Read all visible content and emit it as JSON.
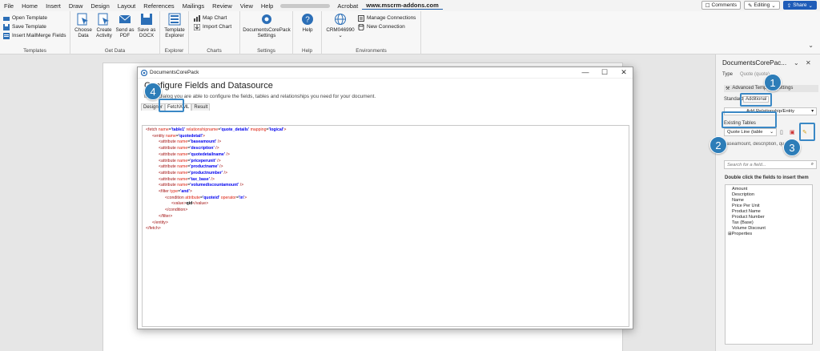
{
  "menubar": {
    "items": [
      "File",
      "Home",
      "Insert",
      "Draw",
      "Design",
      "Layout",
      "References",
      "Mailings",
      "Review",
      "View",
      "Help"
    ],
    "acrobat": "Acrobat",
    "active_tab": "www.mscrm-addons.com",
    "comments": "Comments",
    "editing": "Editing",
    "share": "Share"
  },
  "ribbon": {
    "templates": {
      "open": "Open Template",
      "save": "Save Template",
      "insert": "Insert MailMerge Fields",
      "label": "Templates"
    },
    "getdata": {
      "choose": "Choose Data",
      "create": "Create Activity",
      "sendpdf": "Send as PDF",
      "savedocx": "Save as DOCX",
      "label": "Get Data"
    },
    "explorer": {
      "btn": "Template Explorer",
      "label": "Explorer"
    },
    "charts": {
      "map": "Map Chart",
      "import": "Import Chart",
      "label": "Charts"
    },
    "settings": {
      "btn": "DocumentsCorePack Settings",
      "label": "Settings"
    },
    "help": {
      "btn": "Help",
      "label": "Help"
    },
    "env": {
      "crm": "CRM046990",
      "manage": "Manage Connections",
      "new": "New Connection",
      "label": "Environments"
    }
  },
  "dialog": {
    "title": "DocumentsCorePack",
    "heading": "Configure Fields and Datasource",
    "subtitle": "In this dialog you are able to configure the fields, tables and relationships you need for your document.",
    "tabs": [
      "Designer",
      "FetchXML",
      "Result"
    ]
  },
  "xml": {
    "l1": {
      "fetch": "fetch",
      "n1": "name",
      "v1": "'table1'",
      "n2": "relationshipname",
      "v2": "'quote_details'",
      "n3": "mapping",
      "v3": "'logical'"
    },
    "l2": {
      "entity": "entity",
      "n": "name",
      "v": "'quotedetail'"
    },
    "attributes": [
      "'baseamount'",
      "'description'",
      "'quotedetailname'",
      "'priceperunit'",
      "'productname'",
      "'productnumber'",
      "'tax_base'",
      "'volumediscountamount'"
    ],
    "attr_tag": "attribute",
    "name_attr": "name",
    "filter": {
      "tag": "filter",
      "n": "type",
      "v": "'and'"
    },
    "condition": {
      "tag": "condition",
      "n1": "attribute",
      "v1": "'quoteid'",
      "n2": "operator",
      "v2": "'in'"
    },
    "value": {
      "tag": "value",
      "text": "qid"
    }
  },
  "pane": {
    "title": "DocumentsCorePac...",
    "type_label": "Type",
    "type_value": "Quote (quote)",
    "adv": "Advanced Template Settings",
    "standard": "Standard",
    "additional": "Additional",
    "add_rel": "Add Relationship/Entity",
    "existing": "Existing Tables",
    "quote_line": "Quote Line (table",
    "descr": "baseamount, description, quotedetailname",
    "search": "Search for a field...",
    "double_click": "Double click the fields to insert them",
    "fields": [
      "Amount",
      "Description",
      "Name",
      "Price Per Unit",
      "Product Name",
      "Product Number",
      "Tax (Base)",
      "Volume Discount",
      "Properties"
    ]
  },
  "badges": [
    "1",
    "2",
    "3",
    "4"
  ]
}
